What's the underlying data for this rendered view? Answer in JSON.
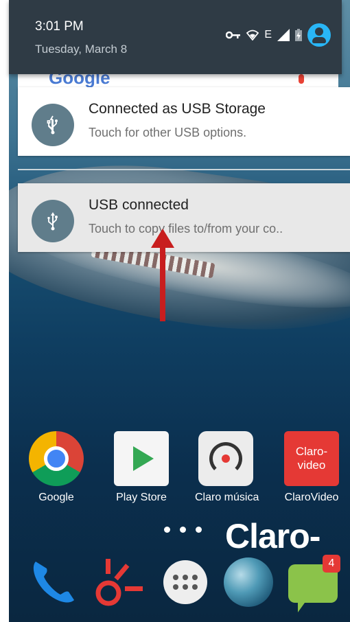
{
  "status_bar": {
    "time": "3:01 PM",
    "date": "Tuesday, March 8",
    "network_type": "E"
  },
  "google_search_peek": {
    "logo_text": "Google"
  },
  "notifications": [
    {
      "title": "Connected as USB Storage",
      "subtitle": "Touch for other USB options."
    },
    {
      "title": "USB connected",
      "subtitle": "Touch to copy files to/from your co.."
    }
  ],
  "apps": [
    {
      "label": "Google"
    },
    {
      "label": "Play Store"
    },
    {
      "label": "Claro música"
    },
    {
      "label": "ClaroVideo",
      "icon_text": "Claro-video"
    }
  ],
  "wallpaper_logo": "Claro-",
  "dock": {
    "messages_badge": "4"
  },
  "colors": {
    "header_bg": "#2f3b45",
    "usb_icon_bg": "#607d8b",
    "arrow": "#c81e1e",
    "avatar": "#29b6f6"
  }
}
